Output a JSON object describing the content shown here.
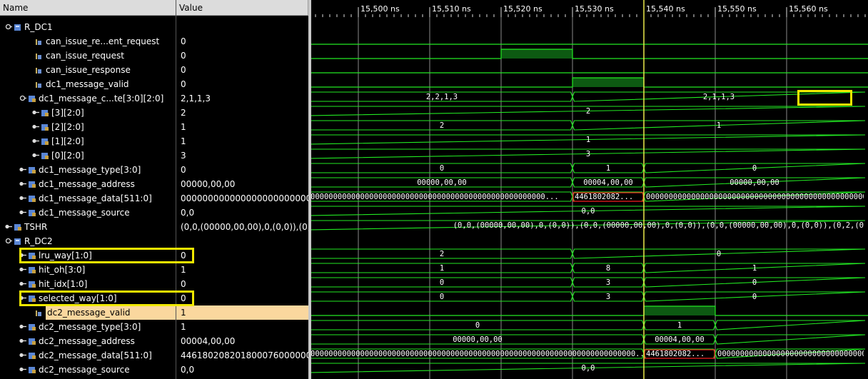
{
  "header": {
    "name": "Name",
    "value": "Value"
  },
  "timeline": {
    "labels": [
      "15,500 ns",
      "15,510 ns",
      "15,520 ns",
      "15,530 ns",
      "15,540 ns",
      "15,550 ns",
      "15,560 ns"
    ],
    "cursor_time": "15,540 ns"
  },
  "signals": [
    {
      "name": "R_DC1",
      "value": "",
      "level": 0,
      "kind": "scope",
      "expand": "open"
    },
    {
      "name": "can_issue_re...ent_request",
      "value": "0",
      "level": 2,
      "kind": "bit"
    },
    {
      "name": "can_issue_request",
      "value": "0",
      "level": 2,
      "kind": "bit"
    },
    {
      "name": "can_issue_response",
      "value": "0",
      "level": 2,
      "kind": "bit"
    },
    {
      "name": "dc1_message_valid",
      "value": "0",
      "level": 2,
      "kind": "bit"
    },
    {
      "name": "dc1_message_c...te[3:0][2:0]",
      "value": "2,1,1,3",
      "level": 1,
      "kind": "bus",
      "expand": "open"
    },
    {
      "name": "[3][2:0]",
      "value": "2",
      "level": 2,
      "kind": "bus",
      "expand": "closed"
    },
    {
      "name": "[2][2:0]",
      "value": "1",
      "level": 2,
      "kind": "bus",
      "expand": "closed"
    },
    {
      "name": "[1][2:0]",
      "value": "1",
      "level": 2,
      "kind": "bus",
      "expand": "closed"
    },
    {
      "name": "[0][2:0]",
      "value": "3",
      "level": 2,
      "kind": "bus",
      "expand": "closed"
    },
    {
      "name": "dc1_message_type[3:0]",
      "value": "0",
      "level": 1,
      "kind": "bus",
      "expand": "closed"
    },
    {
      "name": "dc1_message_address",
      "value": "00000,00,00",
      "level": 1,
      "kind": "bus",
      "expand": "closed"
    },
    {
      "name": "dc1_message_data[511:0]",
      "value": "0000000000000000000000000000000000000",
      "level": 1,
      "kind": "bus",
      "expand": "closed"
    },
    {
      "name": "dc1_message_source",
      "value": "0,0",
      "level": 1,
      "kind": "bus",
      "expand": "closed"
    },
    {
      "name": "TSHR",
      "value": "(0,0,(00000,00,00),0,(0,0)),(0,0,(00000,00,00),0,(0,0))",
      "level": 0,
      "kind": "bus",
      "expand": "closed"
    },
    {
      "name": "R_DC2",
      "value": "",
      "level": 0,
      "kind": "scope",
      "expand": "open"
    },
    {
      "name": "lru_way[1:0]",
      "value": "0",
      "level": 1,
      "kind": "bus",
      "expand": "closed"
    },
    {
      "name": "hit_oh[3:0]",
      "value": "1",
      "level": 1,
      "kind": "bus",
      "expand": "closed"
    },
    {
      "name": "hit_idx[1:0]",
      "value": "0",
      "level": 1,
      "kind": "bus",
      "expand": "closed"
    },
    {
      "name": "selected_way[1:0]",
      "value": "0",
      "level": 1,
      "kind": "bus",
      "expand": "closed"
    },
    {
      "name": "dc2_message_valid",
      "value": "1",
      "level": 2,
      "kind": "bit",
      "selected": true
    },
    {
      "name": "dc2_message_type[3:0]",
      "value": "1",
      "level": 1,
      "kind": "bus",
      "expand": "closed"
    },
    {
      "name": "dc2_message_address",
      "value": "00004,00,00",
      "level": 1,
      "kind": "bus",
      "expand": "closed"
    },
    {
      "name": "dc2_message_data[511:0]",
      "value": "4461802082018000760000000",
      "level": 1,
      "kind": "bus",
      "expand": "closed"
    },
    {
      "name": "dc2_message_source",
      "value": "0,0",
      "level": 1,
      "kind": "bus",
      "expand": "closed"
    }
  ],
  "waves": [
    {
      "row": 1,
      "kind": "bit",
      "highs": []
    },
    {
      "row": 2,
      "kind": "bit",
      "highs": [
        [
          15520,
          15530
        ]
      ]
    },
    {
      "row": 3,
      "kind": "bit",
      "highs": []
    },
    {
      "row": 4,
      "kind": "bit",
      "highs": [
        [
          15530,
          15540
        ]
      ]
    },
    {
      "row": 5,
      "kind": "bus",
      "segments": [
        {
          "start": 15493,
          "end": 15530,
          "label": "2,2,1,3"
        },
        {
          "start": 15530,
          "end": 15571,
          "label": "2,1,1,3"
        }
      ]
    },
    {
      "row": 6,
      "kind": "bus",
      "segments": [
        {
          "start": 15493,
          "end": 15571,
          "label": "2"
        }
      ]
    },
    {
      "row": 7,
      "kind": "bus",
      "segments": [
        {
          "start": 15493,
          "end": 15530,
          "label": "2"
        },
        {
          "start": 15530,
          "end": 15571,
          "label": "1"
        }
      ]
    },
    {
      "row": 8,
      "kind": "bus",
      "segments": [
        {
          "start": 15493,
          "end": 15571,
          "label": "1"
        }
      ]
    },
    {
      "row": 9,
      "kind": "bus",
      "segments": [
        {
          "start": 15493,
          "end": 15571,
          "label": "3"
        }
      ]
    },
    {
      "row": 10,
      "kind": "bus",
      "segments": [
        {
          "start": 15493,
          "end": 15530,
          "label": "0"
        },
        {
          "start": 15530,
          "end": 15540,
          "label": "1"
        },
        {
          "start": 15540,
          "end": 15571,
          "label": "0"
        }
      ]
    },
    {
      "row": 11,
      "kind": "bus",
      "segments": [
        {
          "start": 15493,
          "end": 15530,
          "label": "00000,00,00"
        },
        {
          "start": 15530,
          "end": 15540,
          "label": "00004,00,00"
        },
        {
          "start": 15540,
          "end": 15571,
          "label": "00000,00,00"
        }
      ]
    },
    {
      "row": 12,
      "kind": "bus",
      "segments": [
        {
          "start": 15493,
          "end": 15530,
          "label": "0000000000000000000000000000000000000000000000000000...",
          "leftAlign": true
        },
        {
          "start": 15530,
          "end": 15540,
          "label": "4461802082...",
          "leftAlign": true,
          "error": true
        },
        {
          "start": 15540,
          "end": 15571,
          "label": "00000000000000000000000000000000000000000000000000000000000",
          "leftAlign": true
        }
      ]
    },
    {
      "row": 13,
      "kind": "bus",
      "segments": [
        {
          "start": 15493,
          "end": 15571,
          "label": "0,0"
        }
      ]
    },
    {
      "row": 14,
      "kind": "bus",
      "segments": [
        {
          "start": 15493,
          "end": 15571,
          "label": "(0,0,(00000,00,00),0,(0,0)),(0,0,(00000,00,00),0,(0,0)),(0,0,(00000,00,00),0,(0,0)),(0,2,(0",
          "rightAlign": true
        }
      ]
    },
    {
      "row": 16,
      "kind": "bus",
      "segments": [
        {
          "start": 15493,
          "end": 15530,
          "label": "2"
        },
        {
          "start": 15530,
          "end": 15571,
          "label": "0"
        }
      ]
    },
    {
      "row": 17,
      "kind": "bus",
      "segments": [
        {
          "start": 15493,
          "end": 15530,
          "label": "1"
        },
        {
          "start": 15530,
          "end": 15540,
          "label": "8"
        },
        {
          "start": 15540,
          "end": 15571,
          "label": "1"
        }
      ]
    },
    {
      "row": 18,
      "kind": "bus",
      "segments": [
        {
          "start": 15493,
          "end": 15530,
          "label": "0"
        },
        {
          "start": 15530,
          "end": 15540,
          "label": "3"
        },
        {
          "start": 15540,
          "end": 15571,
          "label": "0"
        }
      ]
    },
    {
      "row": 19,
      "kind": "bus",
      "segments": [
        {
          "start": 15493,
          "end": 15530,
          "label": "0"
        },
        {
          "start": 15530,
          "end": 15540,
          "label": "3"
        },
        {
          "start": 15540,
          "end": 15571,
          "label": "0"
        }
      ]
    },
    {
      "row": 20,
      "kind": "bit",
      "highs": [
        [
          15540,
          15550
        ]
      ]
    },
    {
      "row": 21,
      "kind": "bus",
      "segments": [
        {
          "start": 15493,
          "end": 15540,
          "label": "0"
        },
        {
          "start": 15540,
          "end": 15550,
          "label": "1"
        },
        {
          "start": 15550,
          "end": 15571,
          "label": ""
        }
      ]
    },
    {
      "row": 22,
      "kind": "bus",
      "segments": [
        {
          "start": 15493,
          "end": 15540,
          "label": "00000,00,00"
        },
        {
          "start": 15540,
          "end": 15550,
          "label": "00004,00,00"
        },
        {
          "start": 15550,
          "end": 15571,
          "label": ""
        }
      ]
    },
    {
      "row": 23,
      "kind": "bus",
      "segments": [
        {
          "start": 15493,
          "end": 15540,
          "label": "000000000000000000000000000000000000000000000000000000000000000000000000...",
          "leftAlign": true
        },
        {
          "start": 15540,
          "end": 15550,
          "label": "4461802082...",
          "leftAlign": true,
          "error": true
        },
        {
          "start": 15550,
          "end": 15571,
          "label": "00000000000000000000000000000000000",
          "leftAlign": true
        }
      ]
    },
    {
      "row": 24,
      "kind": "bus",
      "segments": [
        {
          "start": 15493,
          "end": 15571,
          "label": "0,0"
        }
      ]
    }
  ],
  "time_axis": {
    "start": 15493,
    "end": 15571,
    "major_ticks": [
      15500,
      15510,
      15520,
      15530,
      15540,
      15550,
      15560
    ],
    "cursor": 15540
  },
  "colors": {
    "wave": "#22e822",
    "bit_fill": "#0d5a12",
    "grid": "#8a8a8a",
    "cursor": "#eae84a",
    "highlight": "#f0e800",
    "error": "#ff2020",
    "selected_row": "#fad79e"
  },
  "highlights": [
    {
      "target": "lru_way[1:0]"
    },
    {
      "target": "selected_way[1:0]"
    },
    {
      "target": "2,1,1,3"
    }
  ]
}
